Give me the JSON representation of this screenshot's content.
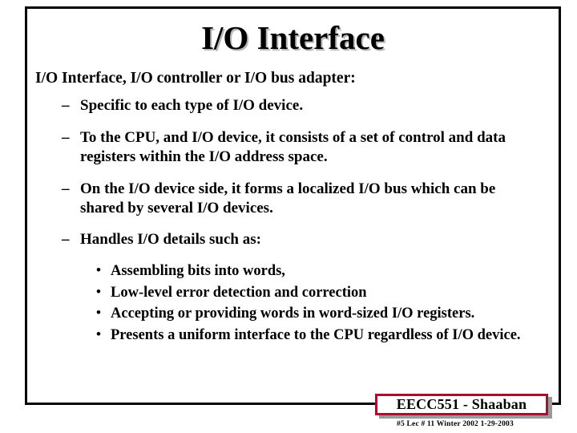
{
  "slide": {
    "title": "I/O Interface",
    "lead": "I/O Interface, I/O controller or I/O bus adapter:",
    "bullet_marker": "–",
    "sub_marker": "•",
    "bullets": [
      {
        "text": "Specific to each type of I/O device."
      },
      {
        "text": "To the CPU, and I/O device, it consists of a set of control and data registers within the I/O address space."
      },
      {
        "text": "On the I/O device side, it forms a localized I/O bus which can be shared by several I/O devices."
      },
      {
        "text": "Handles I/O details such as:"
      }
    ],
    "sub_bullets": [
      {
        "text": "Assembling bits into words,"
      },
      {
        "text": "Low-level error detection and correction"
      },
      {
        "text": "Accepting or providing words in word-sized I/O registers."
      },
      {
        "text": "Presents a uniform interface to the CPU regardless of I/O device."
      }
    ]
  },
  "footer": {
    "badge_label": "EECC551 - Shaaban",
    "note": "#5   Lec # 11  Winter 2002  1-29-2003",
    "badge_border_color": "#a81030",
    "badge_shadow_color": "#9a9a9a"
  }
}
